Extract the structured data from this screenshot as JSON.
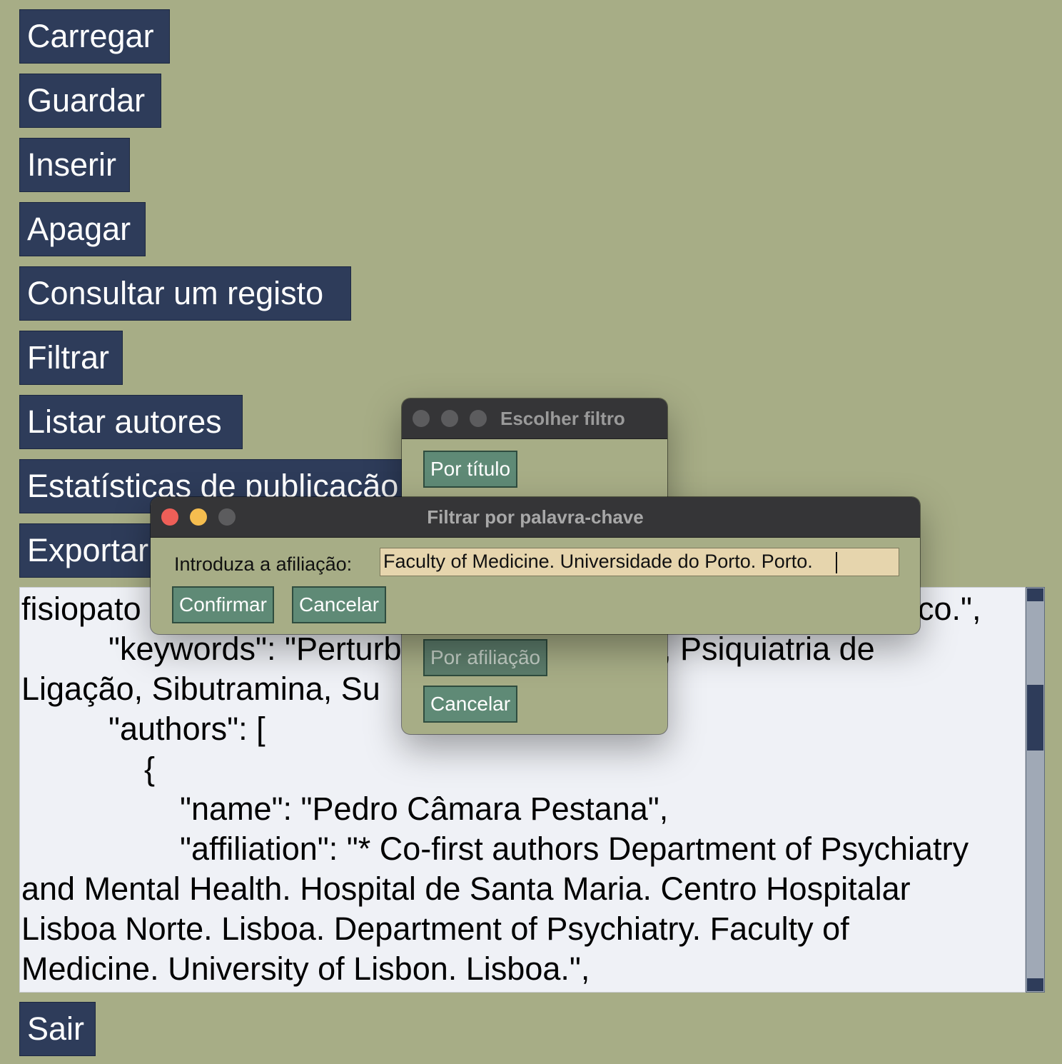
{
  "main_menu": {
    "load": "Carregar",
    "save": "Guardar",
    "insert": "Inserir",
    "delete": "Apagar",
    "query": "Consultar um registo",
    "filter": "Filtrar",
    "list_authors": "Listar autores",
    "stats": "Estatísticas de publicação",
    "export": "Exportar",
    "exit": "Sair"
  },
  "text_area": {
    "lines": [
      "fisiopato",
      "co.\",",
      "        \"keywords\": \"Perturb",
      ", Psiquiatria de",
      "Ligação, Sibutramina, Su",
      "        \"authors\": [",
      "            {",
      "                \"name\": \"Pedro Câmara Pestana\",",
      "                \"affiliation\": \"* Co-first authors Department of Psychiatry",
      "and Mental Health. Hospital de Santa Maria. Centro Hospitalar",
      "Lisboa Norte. Lisboa. Department of Psychiatry. Faculty of",
      "Medicine. University of Lisbon. Lisboa.\","
    ]
  },
  "choose_filter_dialog": {
    "title": "Escolher filtro",
    "by_title": "Por título",
    "by_affiliation": "Por afiliação",
    "cancel": "Cancelar"
  },
  "keyword_filter_dialog": {
    "title": "Filtrar por palavra-chave",
    "label": "Introduza a afiliação:",
    "input_value": "Faculty of Medicine. Universidade do Porto. Porto.",
    "confirm": "Confirmar",
    "cancel": "Cancelar"
  },
  "colors": {
    "background": "#a7ad86",
    "menu_button": "#2e3c5a",
    "dialog_button": "#5f8a76",
    "input_background": "#e6d5ad",
    "titlebar": "#353537"
  }
}
